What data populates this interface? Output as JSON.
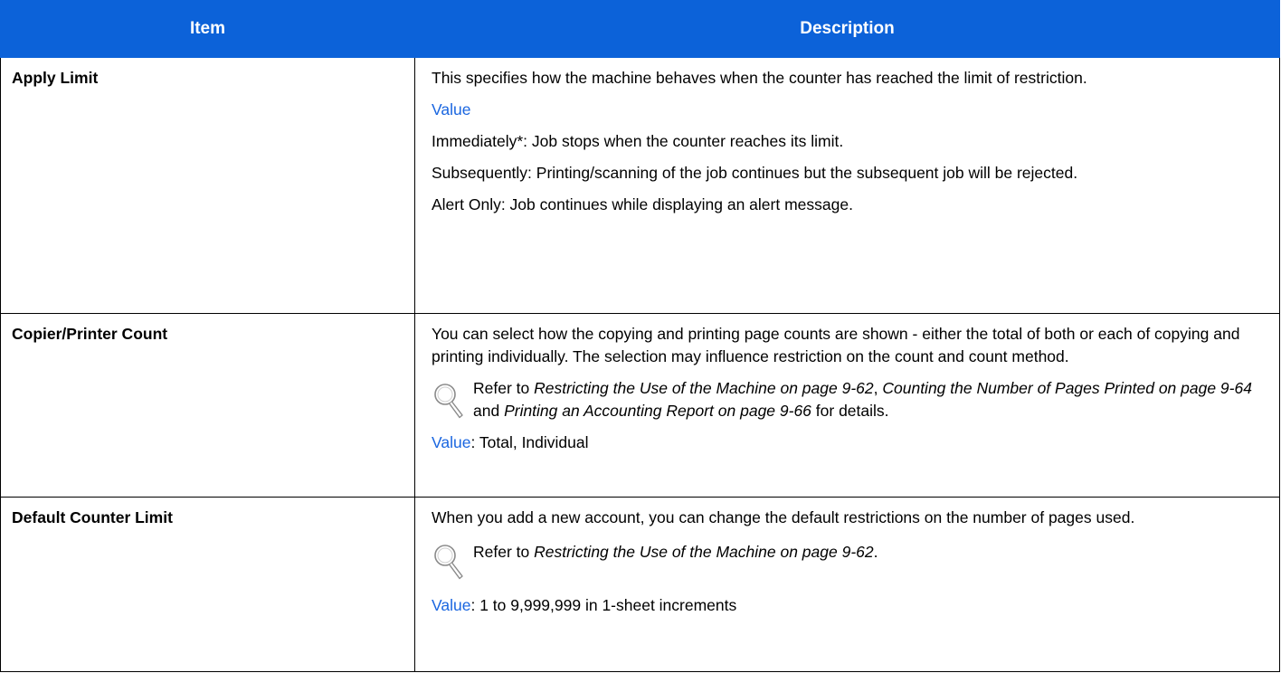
{
  "table": {
    "header": {
      "item": "Item",
      "description": "Description"
    },
    "rows": {
      "apply_limit": {
        "item": "Apply Limit",
        "intro": "This specifies how the machine behaves when the counter has reached the limit of restriction.",
        "value_label": "Value",
        "option_immediately": "Immediately*: Job stops when the counter reaches its limit.",
        "option_subsequently": "Subsequently: Printing/scanning of the job continues but the subsequent job will be rejected.",
        "option_alert_only": "Alert Only: Job continues while displaying an alert message."
      },
      "copier_printer_count": {
        "item": "Copier/Printer Count",
        "intro": "You can select how the copying and printing page counts are shown - either the total of both or each of copying and printing individually. The selection may influence restriction on the count and count method.",
        "ref_prefix": "Refer to ",
        "ref_link_1": "Restricting the Use of the Machine on page 9-62",
        "ref_sep_1": ", ",
        "ref_link_2": "Counting the Number of Pages Printed on page 9-64",
        "ref_sep_2": " and ",
        "ref_link_3": "Printing an Accounting Report on page 9-66",
        "ref_suffix": " for details.",
        "value_label": "Value",
        "value_text": ": Total, Individual"
      },
      "default_counter_limit": {
        "item": "Default Counter Limit",
        "intro": "When you add a new account, you can change the default restrictions on the number of pages used.",
        "ref_prefix": "Refer to ",
        "ref_link_1": "Restricting the Use of the Machine on page 9-62",
        "ref_suffix": ".",
        "value_label": "Value",
        "value_text": ": 1 to 9,999,999 in 1-sheet increments"
      }
    }
  },
  "icons": {
    "reference": "magnifier-icon"
  },
  "colors": {
    "header_bg": "#0c62d9",
    "header_text": "#ffffff",
    "value_label": "#1a66e0",
    "border": "#000000"
  }
}
